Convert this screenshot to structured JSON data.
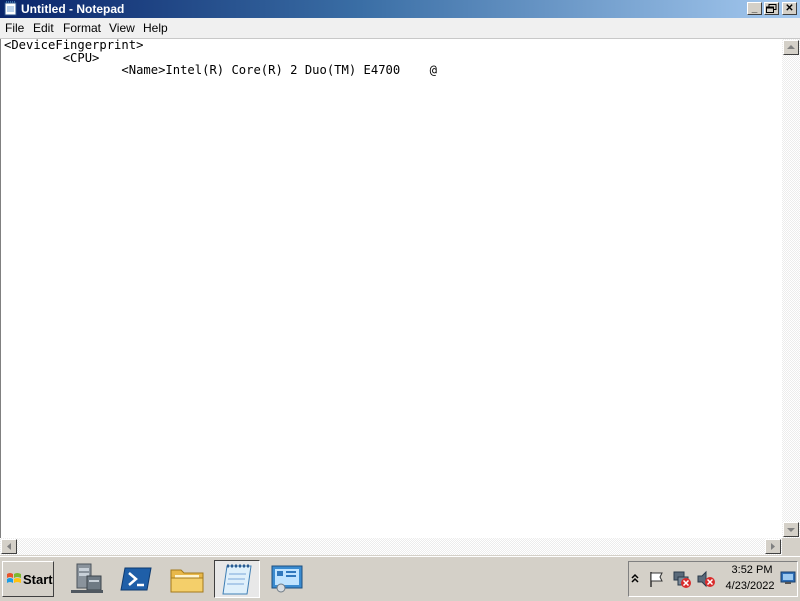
{
  "window": {
    "title": "Untitled - Notepad",
    "controls": {
      "minimize": "_",
      "maximize": "🗗",
      "close": "✕"
    }
  },
  "menu": {
    "items": [
      {
        "label": "File"
      },
      {
        "label": "Edit"
      },
      {
        "label": "Format"
      },
      {
        "label": "View"
      },
      {
        "label": "Help"
      }
    ]
  },
  "editor": {
    "content": "<DeviceFingerprint>\n        <CPU>\n                <Name>Intel(R) Core(R) 2 Duo(TM) E4700    @"
  },
  "taskbar": {
    "start_label": "Start",
    "apps": [
      {
        "name": "server-manager-icon"
      },
      {
        "name": "powershell-icon"
      },
      {
        "name": "file-explorer-icon"
      },
      {
        "name": "notepad-icon",
        "active": true
      },
      {
        "name": "control-panel-icon"
      }
    ],
    "tray": {
      "time": "3:52 PM",
      "date": "4/23/2022",
      "icons": [
        "show-hidden-icons-chevron",
        "action-center-flag-icon",
        "network-error-icon",
        "volume-muted-icon",
        "show-desktop-icon"
      ]
    }
  },
  "colors": {
    "titlebar_start": "#0a246a",
    "titlebar_end": "#a6caf0",
    "chrome": "#d4d0c8"
  }
}
